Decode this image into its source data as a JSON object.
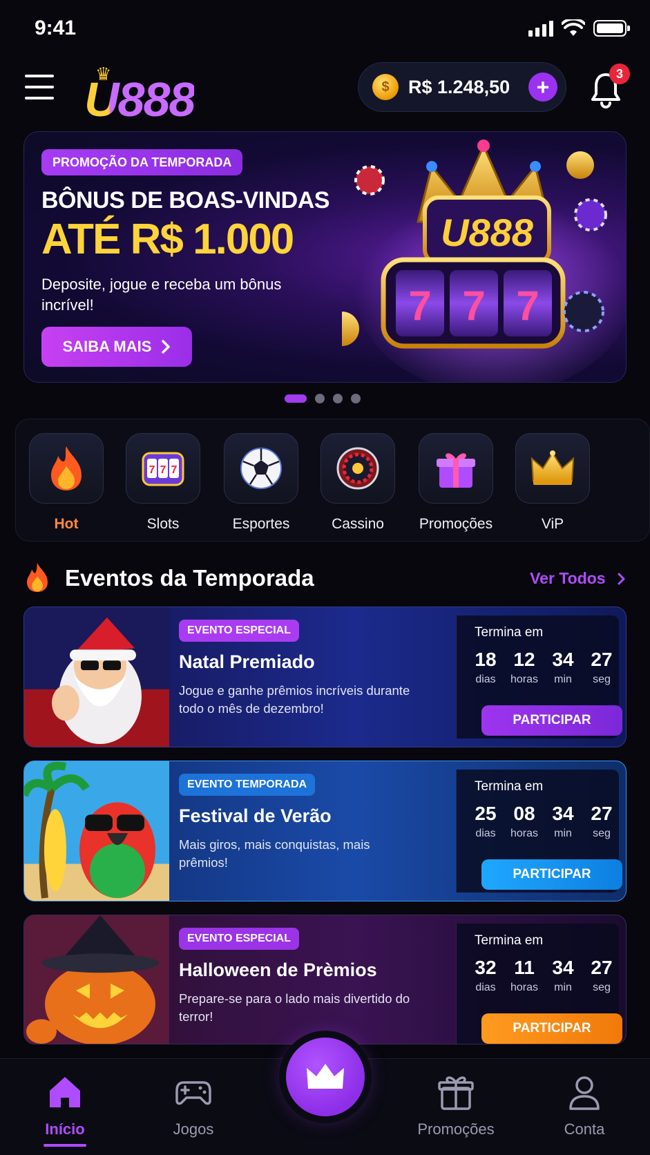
{
  "status_bar": {
    "time": "9:41"
  },
  "header": {
    "logo_text": "U888",
    "balance": "R$ 1.248,50",
    "notifications_count": "3"
  },
  "hero": {
    "tag": "PROMOÇÃO DA TEMPORADA",
    "title_line1": "BÔNUS DE BOAS-VINDAS",
    "title_line2": "ATÉ R$ 1.000",
    "description": "Deposite, jogue e receba um bônus incrível!",
    "cta_label": "SAIBA MAIS",
    "art_logo_text": "U888",
    "carousel_total": 4,
    "carousel_active": 1
  },
  "categories": [
    {
      "label": "Hot",
      "icon": "fire-icon"
    },
    {
      "label": "Slots",
      "icon": "slot-machine-icon"
    },
    {
      "label": "Esportes",
      "icon": "soccer-ball-icon"
    },
    {
      "label": "Cassino",
      "icon": "roulette-icon"
    },
    {
      "label": "Promoções",
      "icon": "gift-icon"
    },
    {
      "label": "ViP",
      "icon": "crown-icon"
    }
  ],
  "events_section": {
    "title": "Eventos da Temporada",
    "see_all": "Ver Todos"
  },
  "events": [
    {
      "tag": "EVENTO ESPECIAL",
      "title": "Natal Premiado",
      "description": "Jogue e ganhe prêmios incríveis durante todo o mês de dezembro!",
      "ends_label": "Termina em",
      "days": "18",
      "hours": "12",
      "minutes": "34",
      "seconds": "27",
      "cta": "PARTICIPAR"
    },
    {
      "tag": "EVENTO TEMPORADA",
      "title": "Festival de Verão",
      "description": "Mais giros, mais conquistas, mais prêmios!",
      "ends_label": "Termina em",
      "days": "25",
      "hours": "08",
      "minutes": "34",
      "seconds": "27",
      "cta": "PARTICIPAR"
    },
    {
      "tag": "EVENTO ESPECIAL",
      "title": "Halloween de Prèmios",
      "description": "Prepare-se para o lado mais divertido do terror!",
      "ends_label": "Termina em",
      "days": "32",
      "hours": "11",
      "minutes": "34",
      "seconds": "27",
      "cta": "PARTICIPAR"
    }
  ],
  "timer_units": {
    "days": "dias",
    "hours": "horas",
    "minutes": "min",
    "seconds": "seg"
  },
  "bottom_nav": {
    "home": "Início",
    "games": "Jogos",
    "promotions": "Promoções",
    "account": "Conta"
  },
  "colors": {
    "accent_purple": "#a23cf0",
    "gold": "#ffd43a",
    "hot_orange": "#ff8a3c",
    "background": "#07070d"
  }
}
